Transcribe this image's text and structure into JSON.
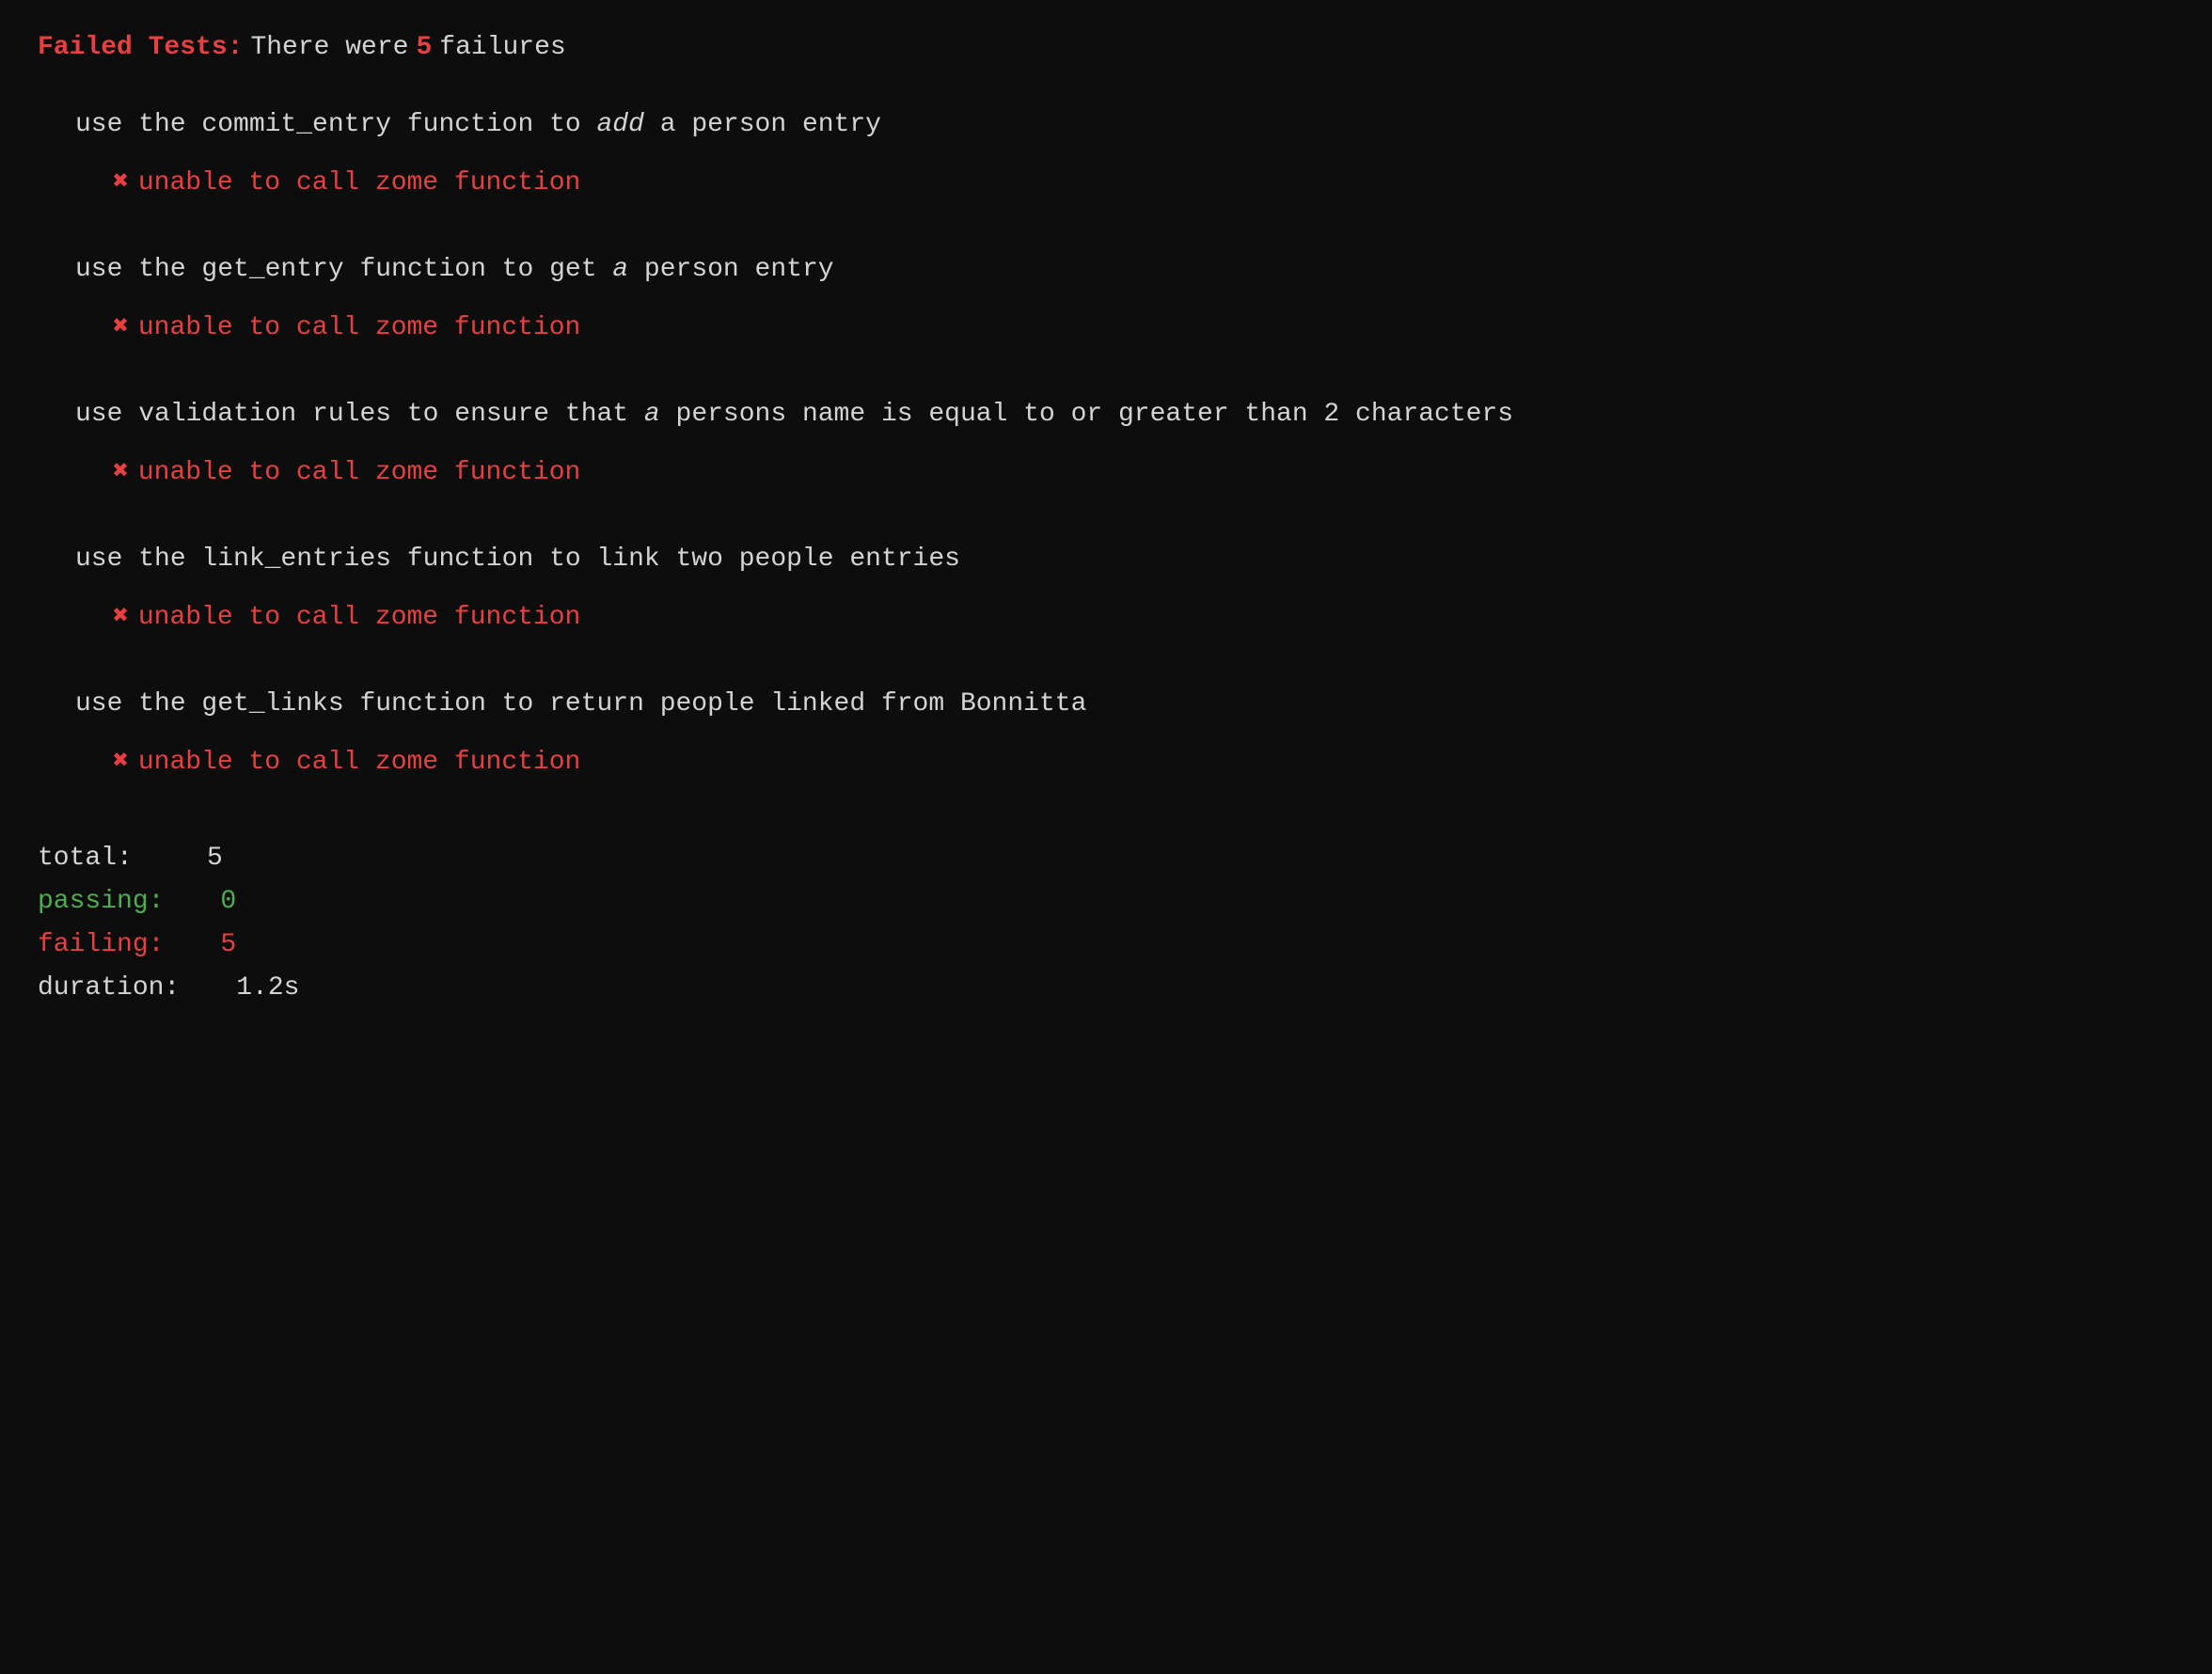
{
  "header": {
    "label": "Failed Tests:",
    "text": "There were",
    "count": "5",
    "suffix": "failures"
  },
  "tests": [
    {
      "description_pre": "use the",
      "function_name": "commit_entry",
      "description_mid": "function to",
      "description_italic": "add",
      "description_post": "a person entry",
      "failure": "unable to call zome function"
    },
    {
      "description_pre": "use the",
      "function_name": "get_entry",
      "description_mid": "function to get",
      "description_italic": "a",
      "description_post": "person entry",
      "failure": "unable to call zome function"
    },
    {
      "description_pre": "use validation rules to ensure that",
      "description_italic": "a",
      "description_post": "persons name is equal to or greater than 2 characters",
      "failure": "unable to call zome function"
    },
    {
      "description_pre": "use the",
      "function_name": "link_entries",
      "description_mid": "function to link two people entries",
      "failure": "unable to call zome function"
    },
    {
      "description_pre": "use the",
      "function_name": "get_links",
      "description_mid": "function to return people linked from Bonnitta",
      "failure": "unable to call zome function"
    }
  ],
  "summary": {
    "total_label": "total:",
    "total_value": "5",
    "passing_label": "passing:",
    "passing_value": "0",
    "failing_label": "failing:",
    "failing_value": "5",
    "duration_label": "duration:",
    "duration_value": "1.2s"
  },
  "icons": {
    "x_mark": "✖"
  }
}
